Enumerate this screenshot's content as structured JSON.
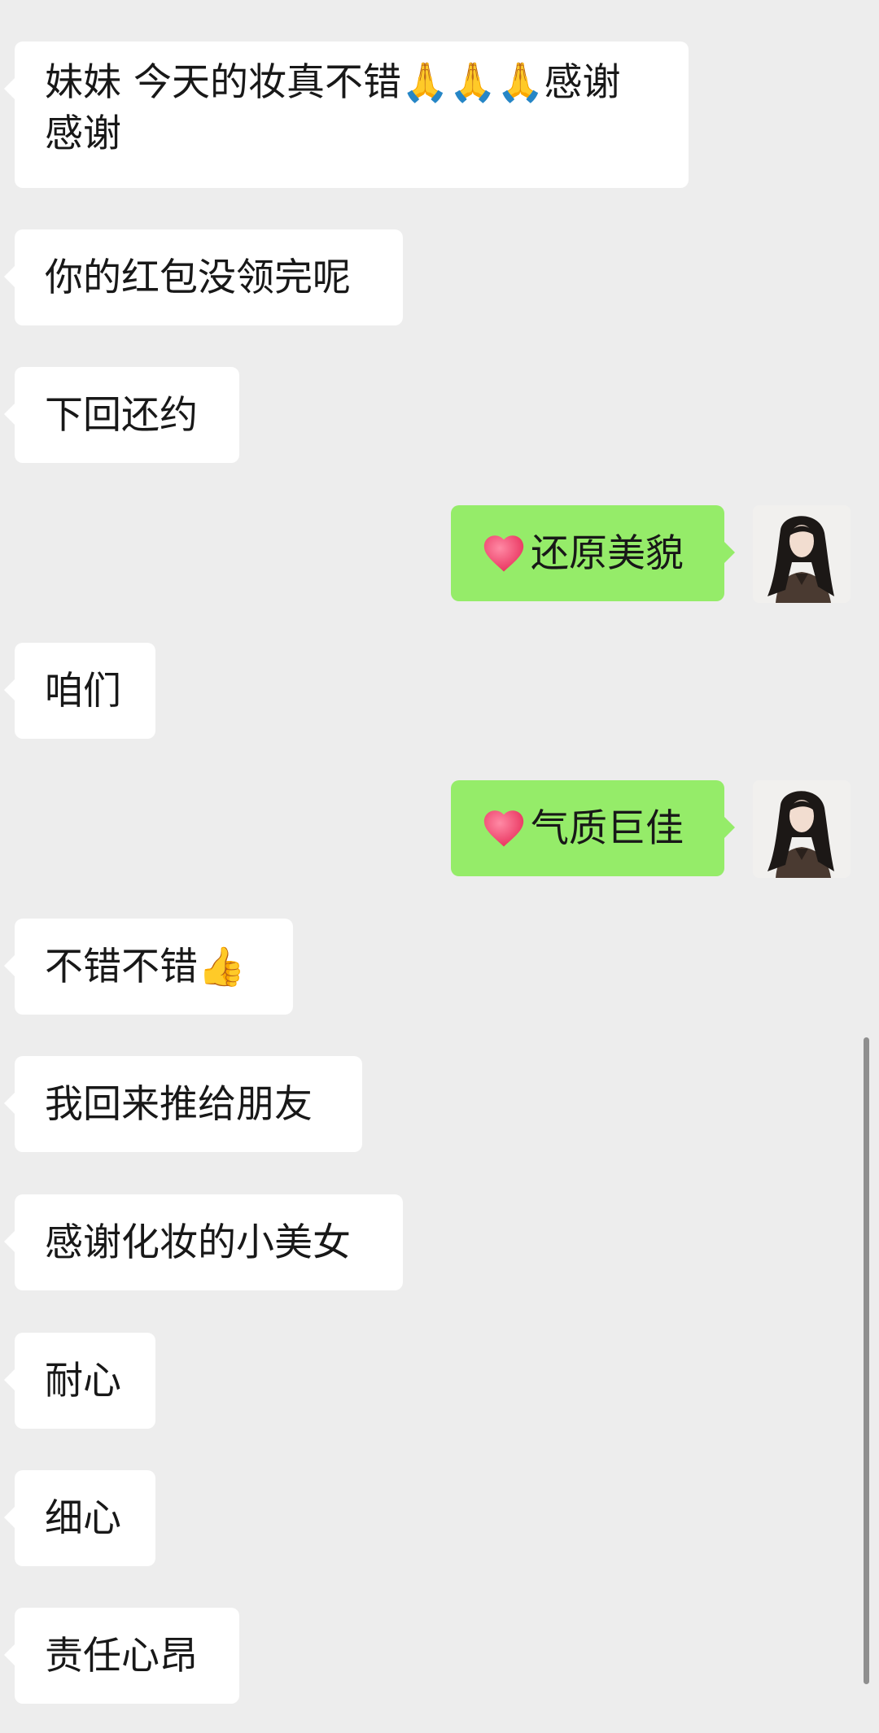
{
  "chat": {
    "messages": [
      {
        "side": "in",
        "text": "妹妹 今天的妆真不错🙏🙏🙏感谢感谢"
      },
      {
        "side": "in",
        "text": "你的红包没领完呢"
      },
      {
        "side": "in",
        "text": "下回还约"
      },
      {
        "side": "out",
        "text": "还原美貌",
        "icon": "heart-icon"
      },
      {
        "side": "in",
        "text": "咱们"
      },
      {
        "side": "out",
        "text": "气质巨佳",
        "icon": "heart-icon"
      },
      {
        "side": "in",
        "text": "不错不错👍"
      },
      {
        "side": "in",
        "text": "我回来推给朋友"
      },
      {
        "side": "in",
        "text": "感谢化妆的小美女"
      },
      {
        "side": "in",
        "text": "耐心"
      },
      {
        "side": "in",
        "text": "细心"
      },
      {
        "side": "in",
        "text": "责任心昂"
      }
    ]
  },
  "colors": {
    "background": "#ededed",
    "incoming_bubble": "#ffffff",
    "outgoing_bubble": "#95ec69",
    "text": "#181818",
    "heart": "#f0446b"
  }
}
